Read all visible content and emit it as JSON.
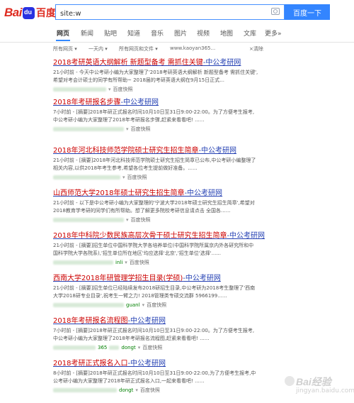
{
  "header": {
    "logo_latin": "Bai",
    "logo_cn": "百度",
    "search_value": "site:w",
    "search_button": "百度一下"
  },
  "nav": {
    "tabs": [
      "网页",
      "新闻",
      "贴吧",
      "知道",
      "音乐",
      "图片",
      "视频",
      "地图",
      "文库",
      "更多»"
    ],
    "active": "网页"
  },
  "filters": {
    "all_pages": "所有网页 ▾",
    "time": "一天内 ▾",
    "files": "所有网页和文件 ▾",
    "site": "www.kaoyan365...",
    "clear": "×清除"
  },
  "results": [
    {
      "title_pre": "2018考研英语大纲解析 新题型备考 需抓住关键",
      "title_site": "-中公考研网",
      "abstract": "21小时前 - 今天中公考研小编为大家整理了'2018考研英语大纲解析 新题型备考 需抓住关键',希望对考会计硕士的同学有所帮助~ 2018届的考研英语大纲在9月15日正式...",
      "snapshot": "百度快照"
    },
    {
      "title_pre": "2018年考研报名步骤",
      "title_site": "-中公考研网",
      "abstract": "7小时前 - [摘要]2018年研正式报名时间10月10日至31日9:00-22:00。为了方便考生报考,中公考研小编为大家整理了2018年考研报名步骤,赶紧来看看吧! ......",
      "snapshot": "百度快照"
    },
    {
      "title_pre": "2018年河北科技师范学院硕士研究生招生简章",
      "title_site": "-中公考研网",
      "abstract": "21小时前 - [摘要]2018年河北科技师范学院硕士研究生招生简章已公布,中公考研小编整理了相关内容,以供2018年考生参考,希望各位考生提前做好准备。......",
      "snapshot": "百度快照"
    },
    {
      "title_pre": "山西师范大学2018年硕士研究生招生简章",
      "title_site": "-中公考研网",
      "abstract": "21小时前 - 以下是中公考研小编为大家整理的'宁波大学2018年硕士研究生招生简章',希望对2018教育学考研的同学们有所帮助。想了解更多院校考研信息请点击 全国各......",
      "snapshot": "百度快照"
    },
    {
      "title_pre": "2018年中科院少数民族高层次骨干硕士研究生招生简章",
      "title_site": "-中公考研网",
      "abstract": "21小时前 - [摘要]招生单位中国科学院大学各培养单位(中国科学院所属京内外各研究所和中国科学院大学各院系),'招生单位所在地区'均应选择'北京','招生单位'选择'......",
      "url_tail": "inli",
      "snapshot": "百度快照"
    },
    {
      "title_pre": "西南大学2018年研管理学招生目录(学硕)",
      "title_site": "-中公考研网",
      "abstract": "21小时前 - [摘要]招生单位已经陆续发布2018研招生目录,中公考研为2018考生整理了'西南大学2018研专业目录',祝考生一臂之力! 2018管理类专硕交流群 5966199......",
      "url_tail": "guanl",
      "snapshot": "百度快照"
    },
    {
      "title_pre": "2018年考研报名流程图",
      "title_site": "-中公考研网",
      "abstract": "7小时前 - [摘要]2018年研正式报名时间10月10日至31日9:00-22:00。为了方便考生报考,中公考研小编为大家整理了2018年考研报名流程图,赶紧来看看吧! ......",
      "url_tail": "365",
      "url_tail2": "dongt",
      "snapshot": "百度快照"
    },
    {
      "title_pre": "2018考研正式报名入口",
      "title_site": "-中公考研网",
      "abstract": "8小时前 - [摘要]2018年研正式报名时间10月10日至31日9:00-22:00,为了方便考生报考,中公考研小编为大家整理了2018年研正式报名入口,一起来看看吧! ......",
      "url_tail": "dongt",
      "snapshot": "百度快照"
    }
  ],
  "watermark": {
    "logo_text": "Bai经验",
    "url": "jingyan.baidu.com"
  }
}
